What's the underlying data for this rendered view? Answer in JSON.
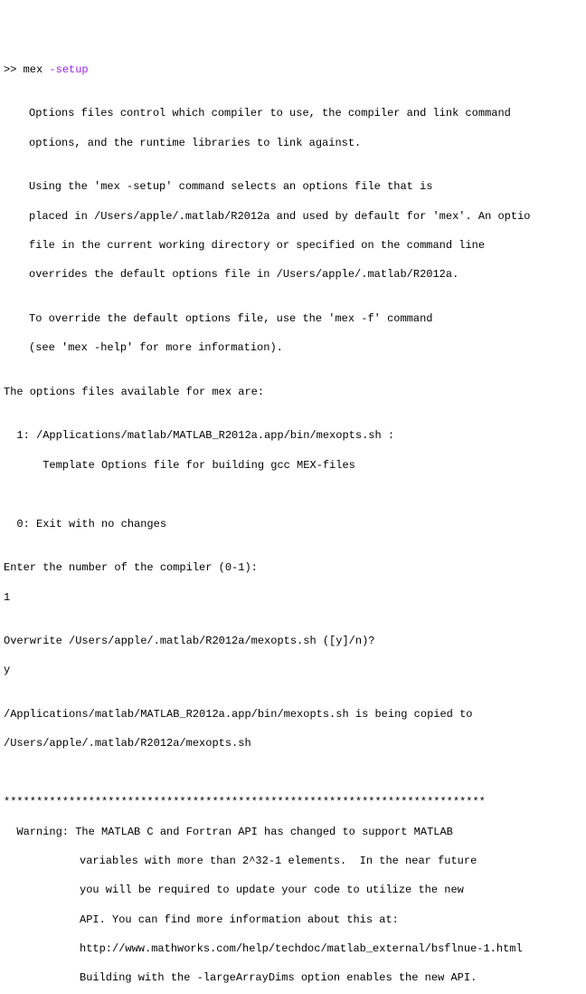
{
  "prompt": ">> ",
  "command_base": "mex ",
  "command_arg": "-setup",
  "blank": "",
  "p1_l1": "Options files control which compiler to use, the compiler and link command",
  "p1_l2": "options, and the runtime libraries to link against.",
  "p2_l1": "Using the 'mex -setup' command selects an options file that is",
  "p2_l2": "placed in /Users/apple/.matlab/R2012a and used by default for 'mex'. An optio",
  "p2_l3": "file in the current working directory or specified on the command line",
  "p2_l4": "overrides the default options file in /Users/apple/.matlab/R2012a.",
  "p3_l1": "To override the default options file, use the 'mex -f' command",
  "p3_l2": "(see 'mex -help' for more information).",
  "avail": "The options files available for mex are:",
  "opt1_l1": "  1: /Applications/matlab/MATLAB_R2012a.app/bin/mexopts.sh :",
  "opt1_l2": "      Template Options file for building gcc MEX-files",
  "opt0": "  0: Exit with no changes",
  "enter_prompt": "Enter the number of the compiler (0-1):",
  "input1": "1",
  "overwrite_prompt": "Overwrite /Users/apple/.matlab/R2012a/mexopts.sh ([y]/n)?",
  "input2": "y",
  "copy_l1": "/Applications/matlab/MATLAB_R2012a.app/bin/mexopts.sh is being copied to",
  "copy_l2": "/Users/apple/.matlab/R2012a/mexopts.sh",
  "stars": "**************************************************************************",
  "warn_l1": "  Warning: The MATLAB C and Fortran API has changed to support MATLAB",
  "warn_l2": "variables with more than 2^32-1 elements.  In the near future",
  "warn_l3": "you will be required to update your code to utilize the new",
  "warn_l4": "API. You can find more information about this at:",
  "warn_l5": "http://www.mathworks.com/help/techdoc/matlab_external/bsflnue-1.html",
  "warn_l6": "Building with the -largeArrayDims option enables the new API."
}
